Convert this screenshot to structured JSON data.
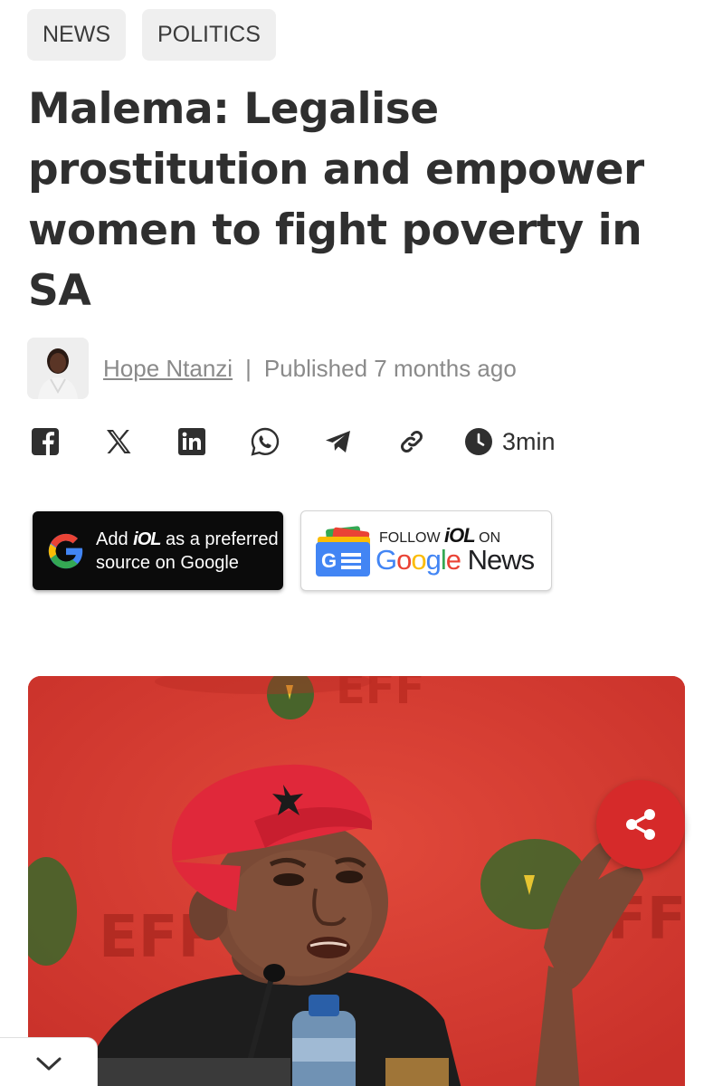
{
  "tags": [
    "NEWS",
    "POLITICS"
  ],
  "headline": "Malema: Legalise prostitution and empower women to fight poverty in SA",
  "byline": {
    "author": "Hope Ntanzi",
    "separator": "|",
    "published": "Published 7 months ago"
  },
  "share": {
    "icons": [
      "facebook-icon",
      "x-icon",
      "linkedin-icon",
      "whatsapp-icon",
      "telegram-icon",
      "link-icon"
    ],
    "read_time": "3min"
  },
  "promo_google": {
    "line1_prefix": "Add",
    "brand": "iOL",
    "line1_suffix": " as a preferred",
    "line2": "source on Google"
  },
  "promo_news": {
    "follow_prefix": "FOLLOW",
    "brand": "iOL",
    "follow_suffix": "ON",
    "google": "Google",
    "news": " News"
  },
  "hero": {
    "backdrop_text": "EFF"
  },
  "colors": {
    "accent_red": "#d62a2a",
    "tag_bg": "#efefef",
    "text_dark": "#2f2f2f",
    "text_muted": "#8a8a8a"
  }
}
